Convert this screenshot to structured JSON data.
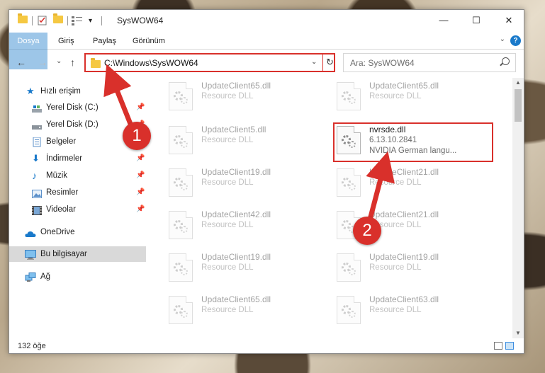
{
  "window": {
    "title": "SysWOW64",
    "minimize": "—",
    "maximize": "☐",
    "close": "✕"
  },
  "ribbon": {
    "tabs": [
      "Dosya",
      "Giriş",
      "Paylaş",
      "Görünüm"
    ],
    "help": "?",
    "collapse": "⌄"
  },
  "navbar": {
    "back": "←",
    "forward": "→",
    "recent": "⌄",
    "up": "↑",
    "address": "C:\\Windows\\SysWOW64",
    "address_dropdown": "⌄",
    "refresh": "↻",
    "search_placeholder": "Ara: SysWOW64"
  },
  "sidebar": {
    "items": [
      {
        "label": "Hızlı erişim",
        "icon": "star-icon"
      },
      {
        "label": "Yerel Disk (C:)",
        "icon": "drive-icon",
        "pin": "📌"
      },
      {
        "label": "Yerel Disk (D:)",
        "icon": "drive-icon",
        "pin": "📌"
      },
      {
        "label": "Belgeler",
        "icon": "documents-icon",
        "pin": "📌"
      },
      {
        "label": "İndirmeler",
        "icon": "download-icon",
        "pin": "📌"
      },
      {
        "label": "Müzik",
        "icon": "music-icon",
        "pin": "📌"
      },
      {
        "label": "Resimler",
        "icon": "pictures-icon",
        "pin": "📌"
      },
      {
        "label": "Videolar",
        "icon": "videos-icon",
        "pin": "📌"
      },
      {
        "label": "OneDrive",
        "icon": "onedrive-icon"
      },
      {
        "label": "Bu bilgisayar",
        "icon": "computer-icon"
      },
      {
        "label": "Ağ",
        "icon": "network-icon"
      }
    ]
  },
  "files": [
    {
      "name": "UpdateClient65.dll",
      "type": "Resource DLL"
    },
    {
      "name": "UpdateClient65.dll",
      "type": "Resource DLL"
    },
    {
      "name": "UpdateClient5.dll",
      "type": "Resource DLL"
    },
    {
      "name": "nvrsde.dll",
      "version": "6.13.10.2841",
      "description": "NVIDIA German langu..."
    },
    {
      "name": "UpdateClient19.dll",
      "type": "Resource DLL"
    },
    {
      "name": "UpdateClient21.dll",
      "type": "Resource DLL"
    },
    {
      "name": "UpdateClient42.dll",
      "type": "Resource DLL"
    },
    {
      "name": "UpdateClient21.dll",
      "type": "Resource DLL"
    },
    {
      "name": "UpdateClient19.dll",
      "type": "Resource DLL"
    },
    {
      "name": "UpdateClient19.dll",
      "type": "Resource DLL"
    },
    {
      "name": "UpdateClient65.dll",
      "type": "Resource DLL"
    },
    {
      "name": "UpdateClient63.dll",
      "type": "Resource DLL"
    }
  ],
  "annotations": {
    "badge1": "1",
    "badge2": "2",
    "color": "#d9302b"
  },
  "status": {
    "item_count": "132 öğe"
  },
  "colors": {
    "accent": "#1979ca",
    "highlight": "#d9302b"
  }
}
